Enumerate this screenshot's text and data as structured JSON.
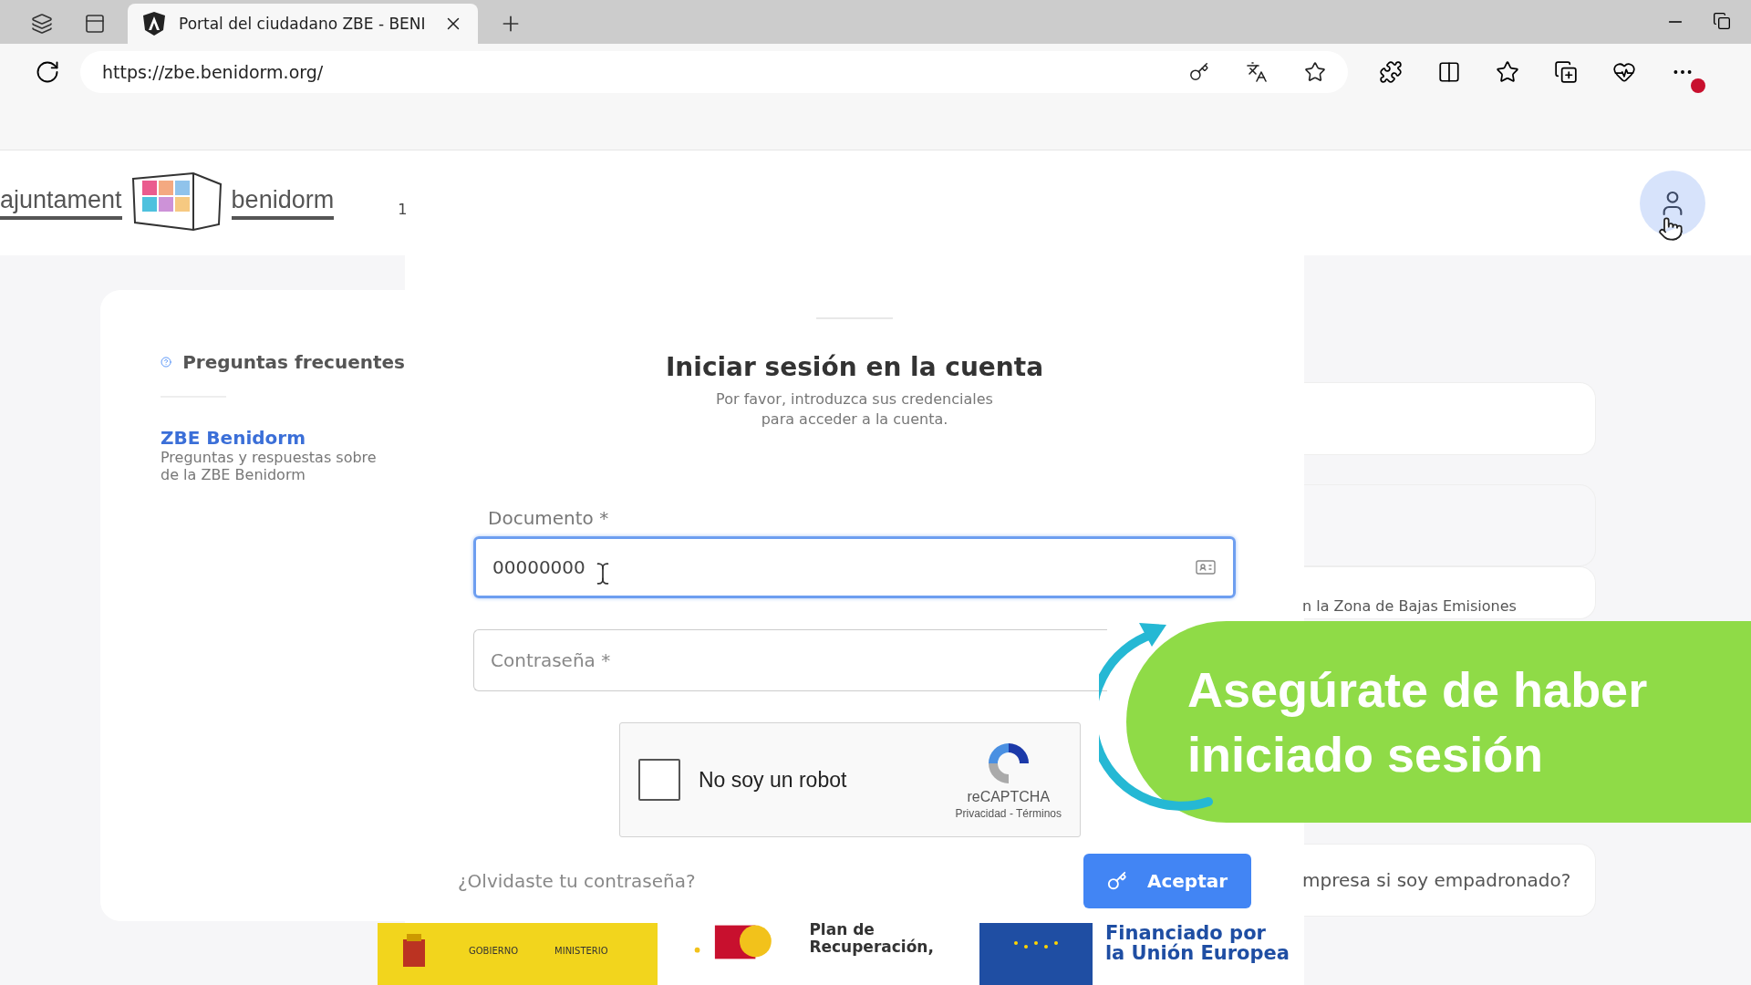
{
  "browser": {
    "tabs": [
      {
        "title": "Portal del ciudadano ZBE - BENI",
        "selected": true
      }
    ],
    "url": "https://zbe.benidorm.org/"
  },
  "header": {
    "logo_left": "ajuntament",
    "logo_right": "benidorm",
    "badge": "1"
  },
  "sidebar": {
    "title": "Preguntas frecuentes",
    "items": [
      {
        "title": "ZBE Benidorm",
        "lines": [
          "Preguntas y respuestas sobre",
          "de la ZBE Benidorm"
        ]
      }
    ]
  },
  "login": {
    "title": "Iniciar sesión en la cuenta",
    "subtitle": "Por favor, introduzca sus credenciales\npara acceder a la cuenta.",
    "fields": [
      {
        "label": "Documento *",
        "value": "00000000",
        "focused": true
      },
      {
        "label": "Contraseña *",
        "focused": false
      }
    ],
    "captcha": {
      "label": "No soy un robot",
      "checked": false,
      "brand": "reCAPTCHA",
      "links": "Privacidad - Términos"
    },
    "forgot_link": "¿Olvidaste tu contraseña?",
    "submit": "Aceptar"
  },
  "faq_cards": [
    {
      "text": "n la Zona de Bajas Emisiones"
    },
    {
      "text": "mpresa si soy empadronado?"
    }
  ],
  "footer": {
    "gov": [
      "GOBIERNO",
      "MINISTERIO"
    ],
    "plan": [
      "Plan de",
      "Recuperación,"
    ],
    "eu": [
      "Financiado por",
      "la Unión Europea"
    ]
  },
  "overlay": {
    "text": "Asegúrate de haber\niniciado sesión"
  }
}
